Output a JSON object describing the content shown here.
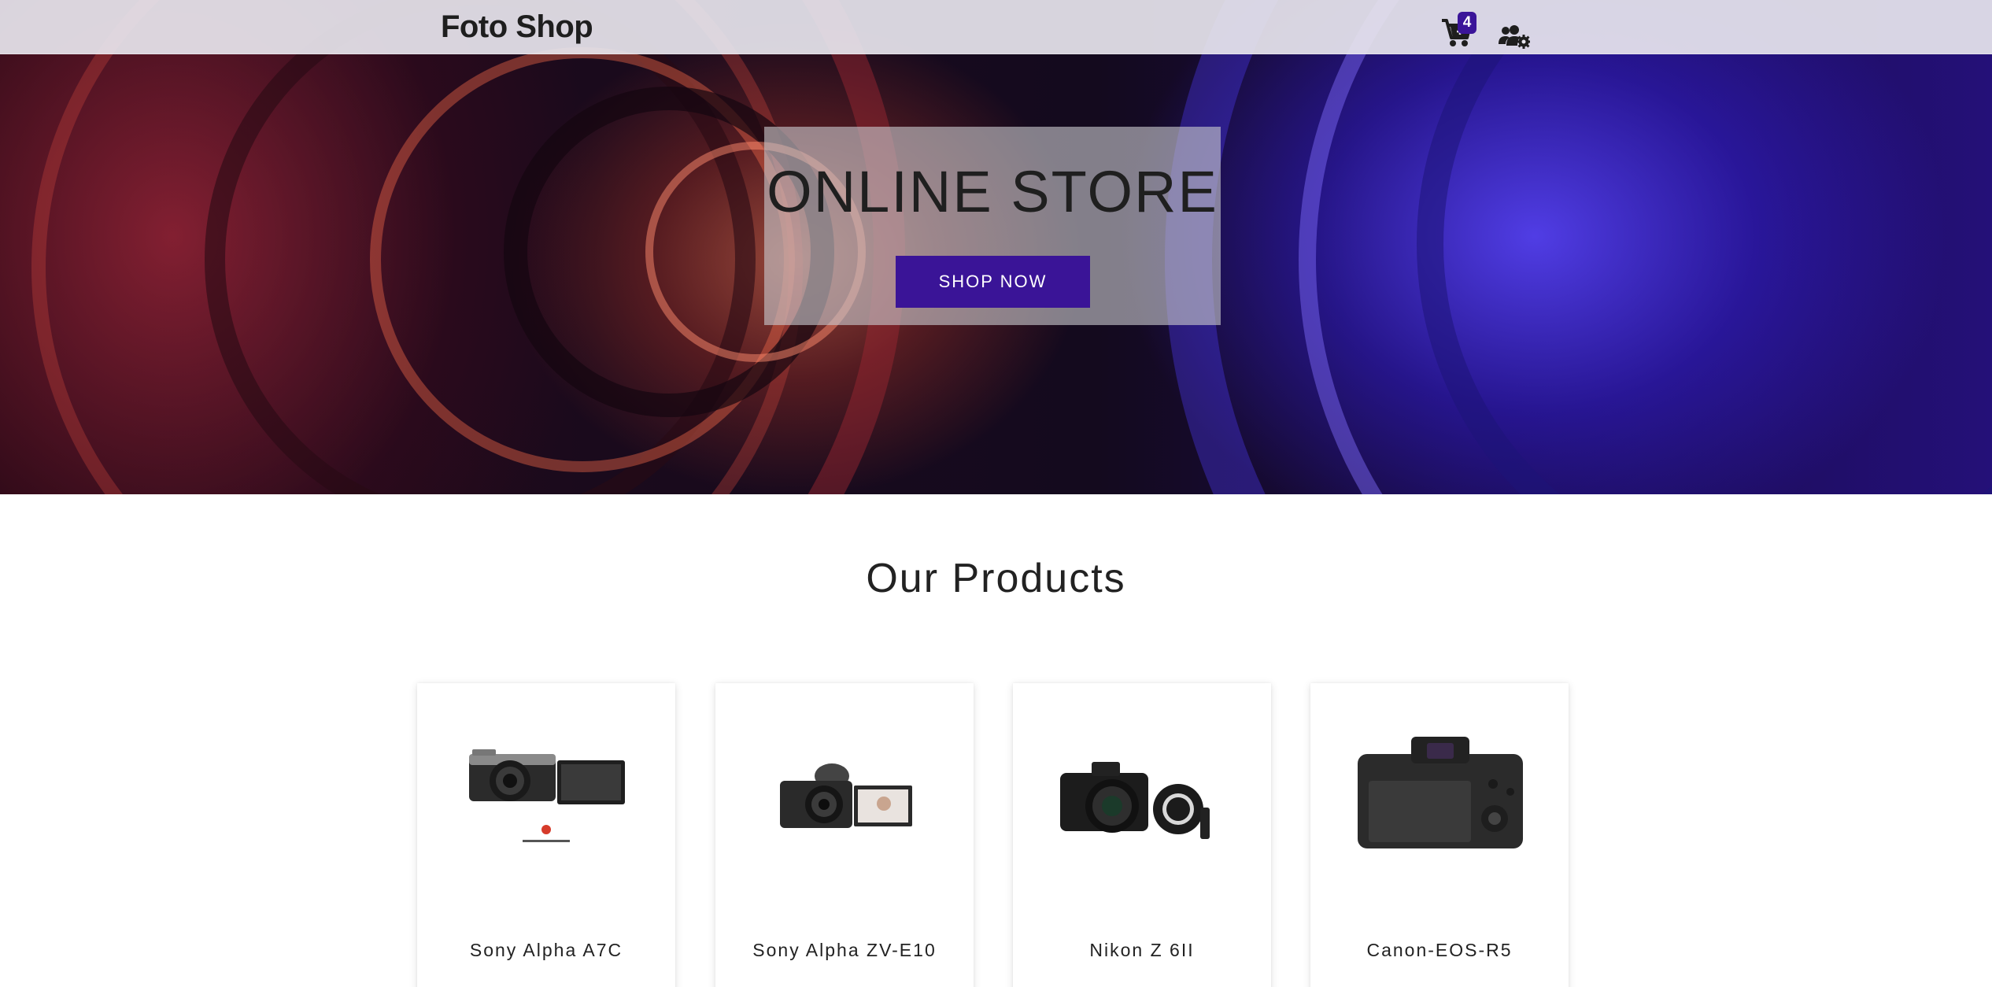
{
  "header": {
    "brand": "Foto Shop",
    "cart_count": "4",
    "cart_icon": "cart-plus-icon",
    "admin_icon": "users-cog-icon"
  },
  "hero": {
    "title": "ONLINE STORE",
    "button_label": "SHOP NOW",
    "background": "camera-lens-photo"
  },
  "products": {
    "title": "Our Products",
    "items": [
      {
        "name": "Sony Alpha A7C",
        "image": "sony-a7c-camera"
      },
      {
        "name": "Sony Alpha ZV-E10",
        "image": "sony-zv-e10-camera"
      },
      {
        "name": "Nikon Z 6II",
        "image": "nikon-z6ii-camera"
      },
      {
        "name": "Canon-EOS-R5",
        "image": "canon-eos-r5-camera"
      }
    ]
  },
  "colors": {
    "accent": "#3a1497",
    "header_bg": "#e8e6ee",
    "text": "#222222"
  }
}
